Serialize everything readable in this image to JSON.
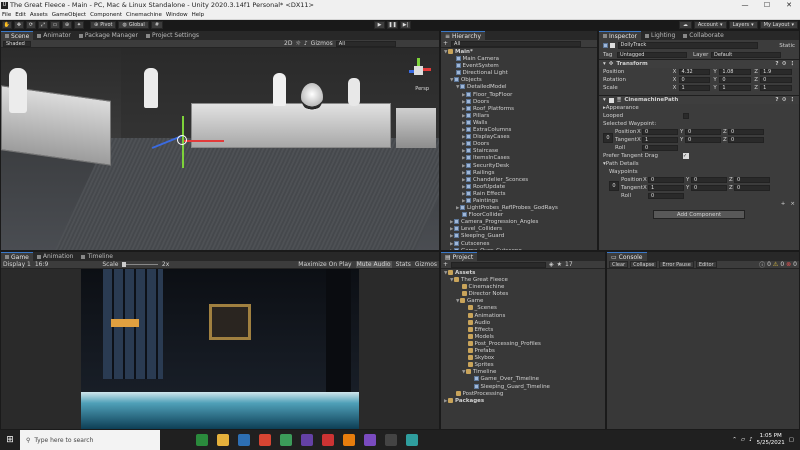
{
  "window": {
    "title": "The Great Fleece - Main - PC, Mac & Linux Standalone - Unity 2020.3.14f1 Personal* <DX11>",
    "min": "—",
    "max": "☐",
    "close": "✕"
  },
  "menu": [
    "File",
    "Edit",
    "Assets",
    "GameObject",
    "Component",
    "Cinemachine",
    "Window",
    "Help"
  ],
  "toolbar": {
    "tools": [
      "✋",
      "✥",
      "⟳",
      "⤢",
      "▭",
      "⊕",
      "✦"
    ],
    "pivot": "Pivot",
    "global": "Global",
    "account": "Account",
    "layers": "Layers",
    "layout": "My Layout"
  },
  "scene": {
    "tabs": [
      "Scene",
      "Animator",
      "Package Manager",
      "Project Settings"
    ],
    "shading": "Shaded",
    "two_d": "2D",
    "gizmos": "Gizmos",
    "search": "All",
    "persp": "Persp"
  },
  "hierarchy": {
    "tab": "Hierarchy",
    "add": "+",
    "search": "All",
    "items": [
      {
        "label": "Main*",
        "depth": 0,
        "type": "scene",
        "expand": "▼"
      },
      {
        "label": "Main Camera",
        "depth": 1,
        "type": "cube"
      },
      {
        "label": "EventSystem",
        "depth": 1,
        "type": "cube"
      },
      {
        "label": "Directional Light",
        "depth": 1,
        "type": "cube"
      },
      {
        "label": "Objects",
        "depth": 1,
        "type": "cube",
        "expand": "▼"
      },
      {
        "label": "DetailedModel",
        "depth": 2,
        "type": "cube",
        "expand": "▼"
      },
      {
        "label": "Floor_TopFloor",
        "depth": 3,
        "type": "cube",
        "expand": "▶"
      },
      {
        "label": "Doors",
        "depth": 3,
        "type": "cube",
        "expand": "▶"
      },
      {
        "label": "Roof_Platforms",
        "depth": 3,
        "type": "cube",
        "expand": "▶"
      },
      {
        "label": "Pillars",
        "depth": 3,
        "type": "cube",
        "expand": "▶"
      },
      {
        "label": "Walls",
        "depth": 3,
        "type": "cube",
        "expand": "▶"
      },
      {
        "label": "ExtraColumns",
        "depth": 3,
        "type": "cube",
        "expand": "▶"
      },
      {
        "label": "DisplayCases",
        "depth": 3,
        "type": "cube",
        "expand": "▶"
      },
      {
        "label": "Doors",
        "depth": 3,
        "type": "cube",
        "expand": "▶"
      },
      {
        "label": "Staircase",
        "depth": 3,
        "type": "cube",
        "expand": "▶"
      },
      {
        "label": "ItemsInCases",
        "depth": 3,
        "type": "cube",
        "expand": "▶"
      },
      {
        "label": "SecurityDesk",
        "depth": 3,
        "type": "cube",
        "expand": "▶"
      },
      {
        "label": "Railings",
        "depth": 3,
        "type": "cube",
        "expand": "▶"
      },
      {
        "label": "Chandelier_Sconces",
        "depth": 3,
        "type": "cube",
        "expand": "▶"
      },
      {
        "label": "RoofUpdate",
        "depth": 3,
        "type": "cube",
        "expand": "▶"
      },
      {
        "label": "Rain Effects",
        "depth": 3,
        "type": "cube",
        "expand": "▶"
      },
      {
        "label": "Paintings",
        "depth": 3,
        "type": "cube",
        "expand": "▶"
      },
      {
        "label": "LightProbes_ReflProbes_GodRays",
        "depth": 2,
        "type": "cube",
        "expand": "▶"
      },
      {
        "label": "FloorCollider",
        "depth": 2,
        "type": "cube"
      },
      {
        "label": "Camera_Progression_Angles",
        "depth": 1,
        "type": "cube",
        "expand": "▶"
      },
      {
        "label": "Level_Colliders",
        "depth": 1,
        "type": "cube",
        "expand": "▶"
      },
      {
        "label": "Sleeping_Guard",
        "depth": 1,
        "type": "cube",
        "expand": "▶"
      },
      {
        "label": "Cutscenes",
        "depth": 1,
        "type": "cube",
        "expand": "▶"
      },
      {
        "label": "Game_Over_Cutscene",
        "depth": 1,
        "type": "cube",
        "expand": "▶"
      },
      {
        "label": "DollyTrack",
        "depth": 1,
        "type": "cube",
        "selected": true
      }
    ]
  },
  "inspector": {
    "tabs": [
      "Inspector",
      "Lighting",
      "Collaborate"
    ],
    "object_name": "DollyTrack",
    "static": "Static",
    "tag_label": "Tag",
    "tag": "Untagged",
    "layer_label": "Layer",
    "layer": "Default",
    "transform": {
      "title": "Transform",
      "position": "Position",
      "rotation": "Rotation",
      "scale": "Scale",
      "pos": [
        "4.32",
        "1.08",
        "1.9"
      ],
      "rot": [
        "0",
        "0",
        "0"
      ],
      "scl": [
        "1",
        "1",
        "1"
      ]
    },
    "path": {
      "title": "CinemachinePath",
      "appearance": "Appearance",
      "looped": "Looped",
      "selected_wp": "Selected Waypoint:",
      "position": "Position",
      "tangent": "Tangent",
      "roll": "Roll",
      "wp_index": "0",
      "sel_pos": [
        "0",
        "0",
        "0"
      ],
      "sel_tan": [
        "1",
        "0",
        "0"
      ],
      "sel_roll": "0",
      "prefer": "Prefer Tangent Drag",
      "details": "Path Details",
      "waypoints": "Waypoints",
      "list_pos": [
        "0",
        "0",
        "0"
      ],
      "list_tan": [
        "1",
        "0",
        "0"
      ],
      "list_roll": "0",
      "plus": "+",
      "x": "×"
    },
    "add_component": "Add Component"
  },
  "game": {
    "tabs": [
      "Game",
      "Animation",
      "Timeline"
    ],
    "display": "Display 1",
    "aspect": "16:9",
    "scale_label": "Scale",
    "scale": "2x",
    "maximize": "Maximize On Play",
    "mute": "Mute Audio",
    "stats": "Stats",
    "gizmos": "Gizmos"
  },
  "project": {
    "tab": "Project",
    "add": "+",
    "count": "17",
    "items": [
      {
        "label": "Assets",
        "depth": 0,
        "bold": true,
        "expand": "▼"
      },
      {
        "label": "The Great Fleece",
        "depth": 1,
        "expand": "▼"
      },
      {
        "label": "Cinemachine",
        "depth": 2
      },
      {
        "label": "Director Notes",
        "depth": 2
      },
      {
        "label": "Game",
        "depth": 2,
        "expand": "▼"
      },
      {
        "label": "_Scenes",
        "depth": 3
      },
      {
        "label": "Animations",
        "depth": 3
      },
      {
        "label": "Audio",
        "depth": 3
      },
      {
        "label": "Effects",
        "depth": 3
      },
      {
        "label": "Models",
        "depth": 3
      },
      {
        "label": "Post_Processing_Profiles",
        "depth": 3
      },
      {
        "label": "Prefabs",
        "depth": 3
      },
      {
        "label": "Skybox",
        "depth": 3
      },
      {
        "label": "Sprites",
        "depth": 3
      },
      {
        "label": "Timeline",
        "depth": 3,
        "expand": "▼"
      },
      {
        "label": "Game_Over_Timeline",
        "depth": 4,
        "file": true
      },
      {
        "label": "Sleeping_Guard_Timeline",
        "depth": 4,
        "file": true
      },
      {
        "label": "PostProcessing",
        "depth": 1
      },
      {
        "label": "Packages",
        "depth": 0,
        "bold": true,
        "expand": "▶"
      }
    ]
  },
  "console": {
    "tab": "Console",
    "clear": "Clear",
    "collapse": "Collapse",
    "error_pause": "Error Pause",
    "editor": "Editor",
    "counts": [
      "0",
      "0",
      "0"
    ]
  },
  "taskbar": {
    "search": "Type here to search",
    "time": "1:05 PM",
    "date": "5/25/2021"
  },
  "colors": {
    "selection": "#2c5d87",
    "accent": "#3a78c8",
    "game_tint": "#4fa0b8"
  }
}
